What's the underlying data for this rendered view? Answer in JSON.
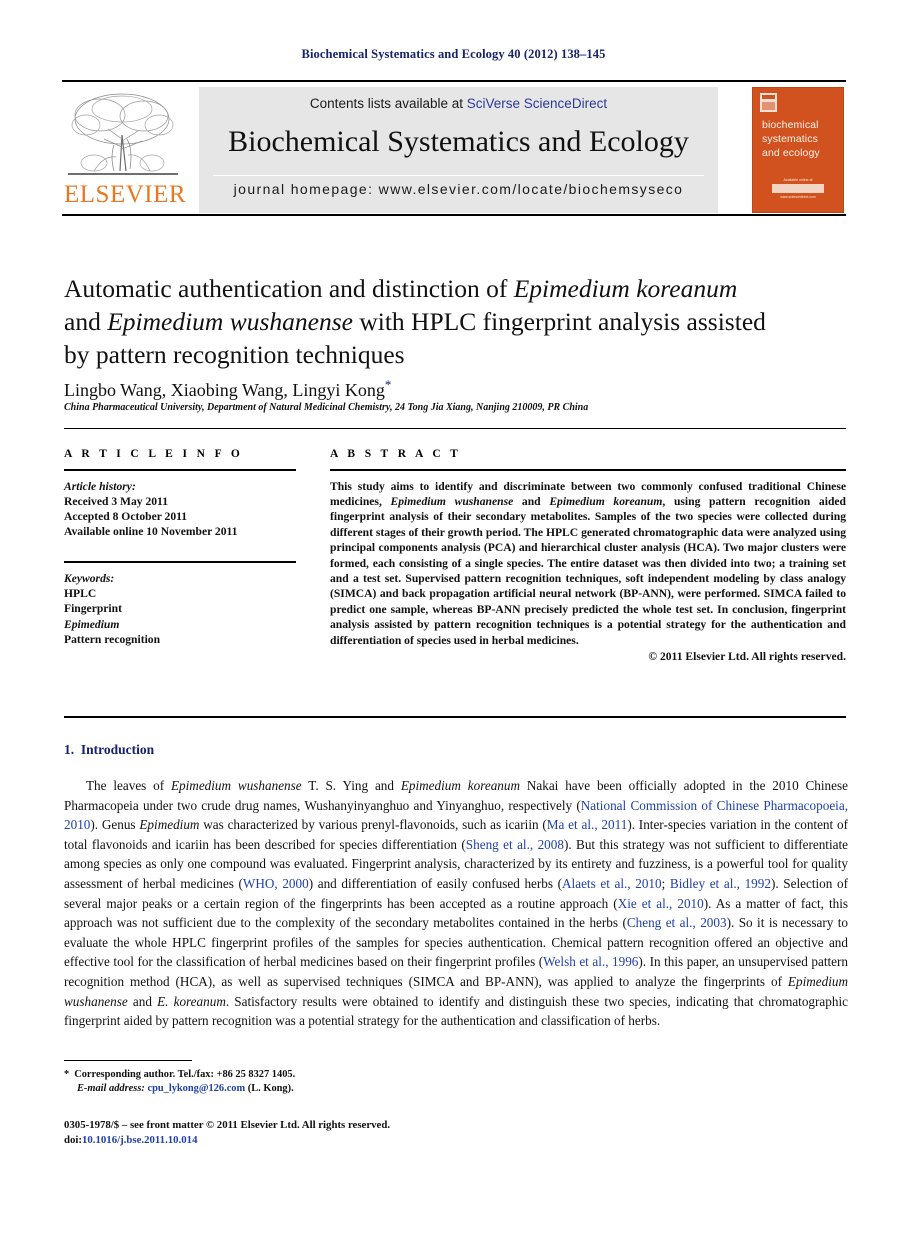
{
  "running_head": "Biochemical Systematics and Ecology 40 (2012) 138–145",
  "masthead": {
    "publisher_wordmark": "ELSEVIER",
    "contents_prefix": "Contents lists available at ",
    "contents_link": "SciVerse ScienceDirect",
    "journal_name": "Biochemical Systematics and Ecology",
    "homepage": "journal homepage: www.elsevier.com/locate/biochemsyseco",
    "cover": {
      "title": "biochemical systematics and ecology",
      "available_line": "Available online at",
      "available_url": "www.sciencedirect.com"
    }
  },
  "article": {
    "title_line1_a": "Automatic authentication and distinction of ",
    "title_line1_i": "Epimedium koreanum",
    "title_line2_a": "and ",
    "title_line2_i": "Epimedium wushanense",
    "title_line2_b": " with HPLC fingerprint analysis assisted",
    "title_line3": "by pattern recognition techniques",
    "authors": "Lingbo Wang, Xiaobing Wang, Lingyi Kong",
    "author_marker": "*",
    "affiliation": "China Pharmaceutical University, Department of Natural Medicinal Chemistry, 24 Tong Jia Xiang, Nanjing 210009, PR China"
  },
  "article_info": {
    "heading": "A R T I C L E    I N F O",
    "history_label": "Article history:",
    "history": [
      "Received 3 May 2011",
      "Accepted 8 October 2011",
      "Available online 10 November 2011"
    ],
    "keywords_label": "Keywords:",
    "keywords": [
      "HPLC",
      "Fingerprint",
      "Epimedium",
      "Pattern recognition"
    ],
    "keyword_italic_index": 2
  },
  "abstract": {
    "heading": "A B S T R A C T",
    "p1": "This study aims to identify and discriminate between two commonly confused traditional Chinese medicines, ",
    "sp1": "Epimedium wushanense",
    "p2": " and ",
    "sp2": "Epimedium koreanum",
    "p3": ", using pattern recognition aided fingerprint analysis of their secondary metabolites. Samples of the two species were collected during different stages of their growth period. The HPLC generated chromatographic data were analyzed using principal components analysis (PCA) and hierarchical cluster analysis (HCA). Two major clusters were formed, each consisting of a single species. The entire dataset was then divided into two; a training set and a test set. Supervised pattern recognition techniques, soft independent modeling by class analogy (SIMCA) and back propagation artificial neural network (BP-ANN), were performed. SIMCA failed to predict one sample, whereas BP-ANN precisely predicted the whole test set. In conclusion, fingerprint analysis assisted by pattern recognition techniques is a potential strategy for the authentication and differentiation of species used in herbal medicines.",
    "copyright": "© 2011 Elsevier Ltd. All rights reserved."
  },
  "introduction": {
    "section_number": "1.",
    "section_name": "Introduction",
    "t1": "The leaves of ",
    "i1": "Epimedium wushanense",
    "t2": " T. S. Ying and ",
    "i2": "Epimedium koreanum",
    "t3": " Nakai have been officially adopted in the 2010 Chinese Pharmacopeia under two crude drug names, Wushanyinyanghuo and Yinyanghuo, respectively (",
    "c1": "National Commission of Chinese Pharmacopoeia, 2010",
    "t4": "). Genus ",
    "i3": "Epimedium",
    "t5": " was characterized by various prenyl-flavonoids, such as icariin (",
    "c2": "Ma et al., 2011",
    "t6": "). Inter-species variation in the content of total flavonoids and icariin has been described for species differentiation (",
    "c3": "Sheng et al., 2008",
    "t7": "). But this strategy was not sufficient to differentiate among species as only one compound was evaluated. Fingerprint analysis, characterized by its entirety and fuzziness, is a powerful tool for quality assessment of herbal medicines (",
    "c4": "WHO, 2000",
    "t8": ") and differentiation of easily confused herbs (",
    "c5": "Alaets et al., 2010",
    "t9": "; ",
    "c6": "Bidley et al., 1992",
    "t10": "). Selection of several major peaks or a certain region of the fingerprints has been accepted as a routine approach (",
    "c7": "Xie et al., 2010",
    "t11": "). As a matter of fact, this approach was not sufficient due to the complexity of the secondary metabolites contained in the herbs (",
    "c8": "Cheng et al., 2003",
    "t12": "). So it is necessary to evaluate the whole HPLC fingerprint profiles of the samples for species authentication. Chemical pattern recognition offered an objective and effective tool for the classification of herbal medicines based on their fingerprint profiles (",
    "c9": "Welsh et al., 1996",
    "t13": "). In this paper, an unsupervised pattern recognition method (HCA), as well as supervised techniques (SIMCA and BP-ANN), was applied to analyze the fingerprints of ",
    "i4": "Epimedium wushanense",
    "t14": " and ",
    "i5": "E. koreanum",
    "t15": ". Satisfactory results were obtained to identify and distinguish these two species, indicating that chromatographic fingerprint aided by pattern recognition was a potential strategy for the authentication and classification of herbs."
  },
  "footnote": {
    "marker": "*",
    "corresponding": "Corresponding author. Tel./fax: +86 25 8327 1405.",
    "email_label": "E-mail address:",
    "email": "cpu_lykong@126.com",
    "email_owner": "(L. Kong)."
  },
  "imprint": {
    "front_matter": "0305-1978/$ – see front matter © 2011 Elsevier Ltd. All rights reserved.",
    "doi_label": "doi:",
    "doi": "10.1016/j.bse.2011.10.014"
  },
  "colors": {
    "journal_blue": "#16226b",
    "link_blue": "#2140a8",
    "sciencedirect_blue": "#2a3a9c",
    "elsevier_orange": "#e87722",
    "cover_orange": "#d2521f",
    "banner_gray": "#e6e6e6"
  }
}
